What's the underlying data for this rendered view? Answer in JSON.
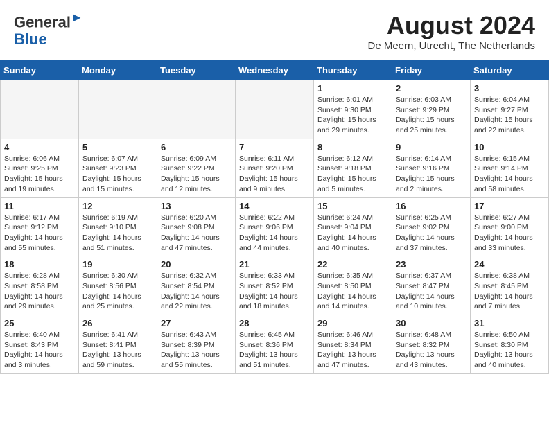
{
  "header": {
    "logo_line1": "General",
    "logo_line2": "Blue",
    "month": "August 2024",
    "location": "De Meern, Utrecht, The Netherlands"
  },
  "weekdays": [
    "Sunday",
    "Monday",
    "Tuesday",
    "Wednesday",
    "Thursday",
    "Friday",
    "Saturday"
  ],
  "weeks": [
    [
      {
        "day": "",
        "info": ""
      },
      {
        "day": "",
        "info": ""
      },
      {
        "day": "",
        "info": ""
      },
      {
        "day": "",
        "info": ""
      },
      {
        "day": "1",
        "info": "Sunrise: 6:01 AM\nSunset: 9:30 PM\nDaylight: 15 hours\nand 29 minutes."
      },
      {
        "day": "2",
        "info": "Sunrise: 6:03 AM\nSunset: 9:29 PM\nDaylight: 15 hours\nand 25 minutes."
      },
      {
        "day": "3",
        "info": "Sunrise: 6:04 AM\nSunset: 9:27 PM\nDaylight: 15 hours\nand 22 minutes."
      }
    ],
    [
      {
        "day": "4",
        "info": "Sunrise: 6:06 AM\nSunset: 9:25 PM\nDaylight: 15 hours\nand 19 minutes."
      },
      {
        "day": "5",
        "info": "Sunrise: 6:07 AM\nSunset: 9:23 PM\nDaylight: 15 hours\nand 15 minutes."
      },
      {
        "day": "6",
        "info": "Sunrise: 6:09 AM\nSunset: 9:22 PM\nDaylight: 15 hours\nand 12 minutes."
      },
      {
        "day": "7",
        "info": "Sunrise: 6:11 AM\nSunset: 9:20 PM\nDaylight: 15 hours\nand 9 minutes."
      },
      {
        "day": "8",
        "info": "Sunrise: 6:12 AM\nSunset: 9:18 PM\nDaylight: 15 hours\nand 5 minutes."
      },
      {
        "day": "9",
        "info": "Sunrise: 6:14 AM\nSunset: 9:16 PM\nDaylight: 15 hours\nand 2 minutes."
      },
      {
        "day": "10",
        "info": "Sunrise: 6:15 AM\nSunset: 9:14 PM\nDaylight: 14 hours\nand 58 minutes."
      }
    ],
    [
      {
        "day": "11",
        "info": "Sunrise: 6:17 AM\nSunset: 9:12 PM\nDaylight: 14 hours\nand 55 minutes."
      },
      {
        "day": "12",
        "info": "Sunrise: 6:19 AM\nSunset: 9:10 PM\nDaylight: 14 hours\nand 51 minutes."
      },
      {
        "day": "13",
        "info": "Sunrise: 6:20 AM\nSunset: 9:08 PM\nDaylight: 14 hours\nand 47 minutes."
      },
      {
        "day": "14",
        "info": "Sunrise: 6:22 AM\nSunset: 9:06 PM\nDaylight: 14 hours\nand 44 minutes."
      },
      {
        "day": "15",
        "info": "Sunrise: 6:24 AM\nSunset: 9:04 PM\nDaylight: 14 hours\nand 40 minutes."
      },
      {
        "day": "16",
        "info": "Sunrise: 6:25 AM\nSunset: 9:02 PM\nDaylight: 14 hours\nand 37 minutes."
      },
      {
        "day": "17",
        "info": "Sunrise: 6:27 AM\nSunset: 9:00 PM\nDaylight: 14 hours\nand 33 minutes."
      }
    ],
    [
      {
        "day": "18",
        "info": "Sunrise: 6:28 AM\nSunset: 8:58 PM\nDaylight: 14 hours\nand 29 minutes."
      },
      {
        "day": "19",
        "info": "Sunrise: 6:30 AM\nSunset: 8:56 PM\nDaylight: 14 hours\nand 25 minutes."
      },
      {
        "day": "20",
        "info": "Sunrise: 6:32 AM\nSunset: 8:54 PM\nDaylight: 14 hours\nand 22 minutes."
      },
      {
        "day": "21",
        "info": "Sunrise: 6:33 AM\nSunset: 8:52 PM\nDaylight: 14 hours\nand 18 minutes."
      },
      {
        "day": "22",
        "info": "Sunrise: 6:35 AM\nSunset: 8:50 PM\nDaylight: 14 hours\nand 14 minutes."
      },
      {
        "day": "23",
        "info": "Sunrise: 6:37 AM\nSunset: 8:47 PM\nDaylight: 14 hours\nand 10 minutes."
      },
      {
        "day": "24",
        "info": "Sunrise: 6:38 AM\nSunset: 8:45 PM\nDaylight: 14 hours\nand 7 minutes."
      }
    ],
    [
      {
        "day": "25",
        "info": "Sunrise: 6:40 AM\nSunset: 8:43 PM\nDaylight: 14 hours\nand 3 minutes."
      },
      {
        "day": "26",
        "info": "Sunrise: 6:41 AM\nSunset: 8:41 PM\nDaylight: 13 hours\nand 59 minutes."
      },
      {
        "day": "27",
        "info": "Sunrise: 6:43 AM\nSunset: 8:39 PM\nDaylight: 13 hours\nand 55 minutes."
      },
      {
        "day": "28",
        "info": "Sunrise: 6:45 AM\nSunset: 8:36 PM\nDaylight: 13 hours\nand 51 minutes."
      },
      {
        "day": "29",
        "info": "Sunrise: 6:46 AM\nSunset: 8:34 PM\nDaylight: 13 hours\nand 47 minutes."
      },
      {
        "day": "30",
        "info": "Sunrise: 6:48 AM\nSunset: 8:32 PM\nDaylight: 13 hours\nand 43 minutes."
      },
      {
        "day": "31",
        "info": "Sunrise: 6:50 AM\nSunset: 8:30 PM\nDaylight: 13 hours\nand 40 minutes."
      }
    ]
  ]
}
